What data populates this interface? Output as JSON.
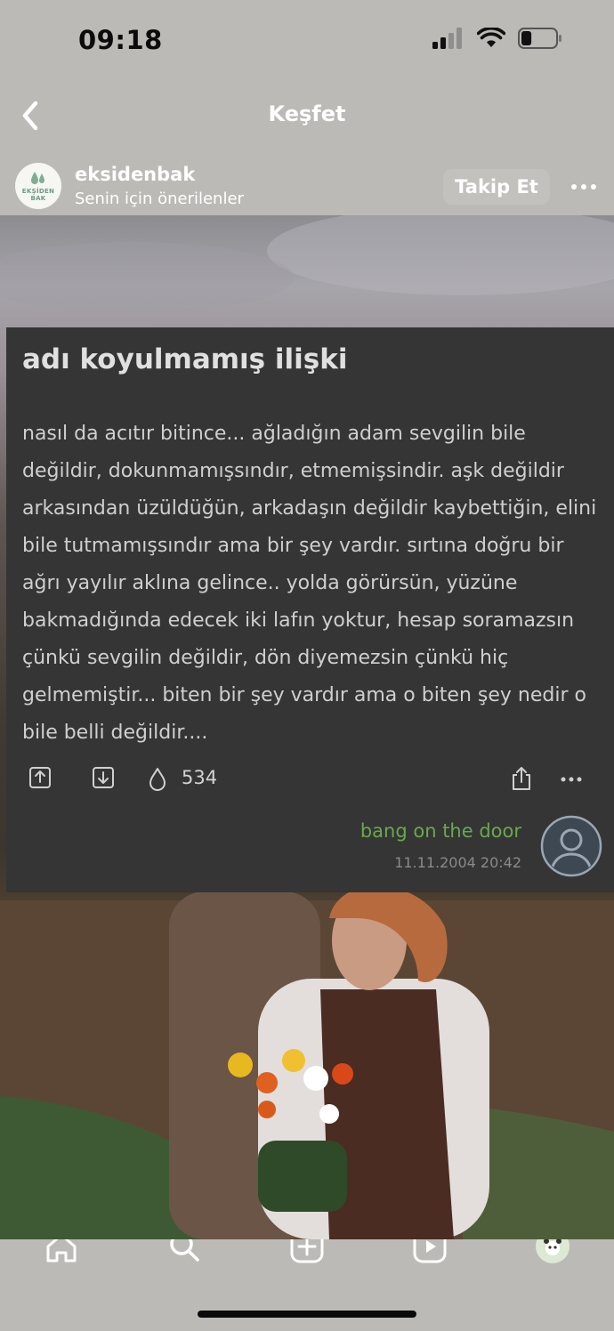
{
  "status_bar": {
    "time": "09:18",
    "battery_level": 0.3
  },
  "nav": {
    "title": "Keşfet",
    "back_icon": "chevron-left-icon"
  },
  "profile": {
    "username": "eksidenbak",
    "subtitle": "Senin için önerilenler",
    "avatar_text": "EKŞİDEN BAK",
    "follow_label": "Takip Et",
    "more_icon": "ellipsis-icon"
  },
  "entry": {
    "title": "adı koyulmamış ilişki",
    "body": "nasıl da acıtır bitince... ağladığın adam sevgilin bile değildir, dokunmamışsındır, etmemişsindir. aşk değildir arkasından üzüldüğün, arkadaşın değildir kaybettiğin, elini bile tutmamışsındır ama bir şey vardır. sırtına doğru bir ağrı yayılır aklına gelince.. yolda görürsün, yüzüne bakmadığında edecek iki lafın yoktur, hesap soramazsın çünkü sevgilin değildir, dön diyemezsin çünkü hiç gelmemiştir... biten bir şey vardır ama o biten şey nedir o bile belli değildir....",
    "drop_count": "534",
    "author": "bang on the door",
    "date": "11.11.2004 20:42"
  },
  "colors": {
    "background": "#bcbab6",
    "card": "#353535",
    "author_link": "#6aa84f"
  },
  "tabbar": {
    "items": [
      "home-icon",
      "search-icon",
      "add-post-icon",
      "reels-icon",
      "profile-avatar"
    ]
  }
}
